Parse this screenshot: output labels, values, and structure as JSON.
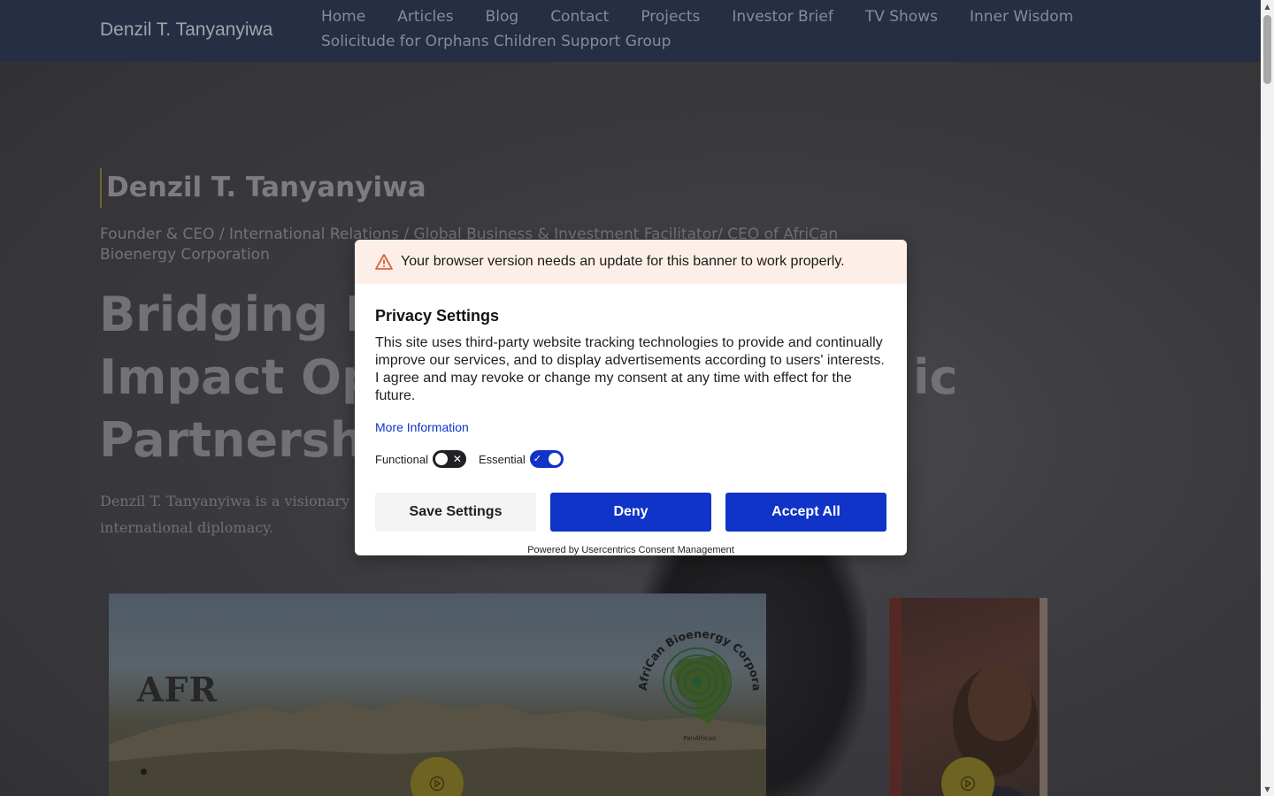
{
  "nav": {
    "brand": "Denzil T. Tanyanyiwa",
    "links": [
      "Home",
      "Articles",
      "Blog",
      "Contact",
      "Projects",
      "Investor Brief",
      "TV Shows",
      "Inner Wisdom",
      "Solicitude for Orphans Children Support Group"
    ]
  },
  "hero": {
    "name": "Denzil T. Tanyanyiwa",
    "subtitle": "Founder & CEO / International Relations / Global Business & Investment Facilitator/ CEO of AfriCan Bioenergy Corporation",
    "title_lines": [
      "Bridging I",
      "Impact Op",
      "Partnersh"
    ],
    "title_right": "ic",
    "description": "Denzil T. Tanyanyiwa is a visionary lea",
    "description_line2": "international diplomacy."
  },
  "media": {
    "afr_text": "AFR",
    "logo_text": "AfriCan Bioenergy Corporation",
    "logo_sub": "PanAfrican"
  },
  "consent": {
    "warning": "Your browser version needs an update for this banner to work properly.",
    "title": "Privacy Settings",
    "text": "This site uses third-party website tracking technologies to provide and continually improve our services, and to display advertisements according to users' interests. I agree and may revoke or change my consent at any time with effect for the future.",
    "more_info": "More Information",
    "toggles": [
      {
        "label": "Functional",
        "on": false
      },
      {
        "label": "Essential",
        "on": true
      }
    ],
    "buttons": {
      "save": "Save Settings",
      "deny": "Deny",
      "accept": "Accept All"
    },
    "powered": "Powered by Usercentrics Consent Management"
  },
  "colors": {
    "accent_blue": "#1033c8",
    "warning_bg": "#fdefe8",
    "warning_icon": "#e0603a",
    "play_button": "#8a7a25"
  }
}
